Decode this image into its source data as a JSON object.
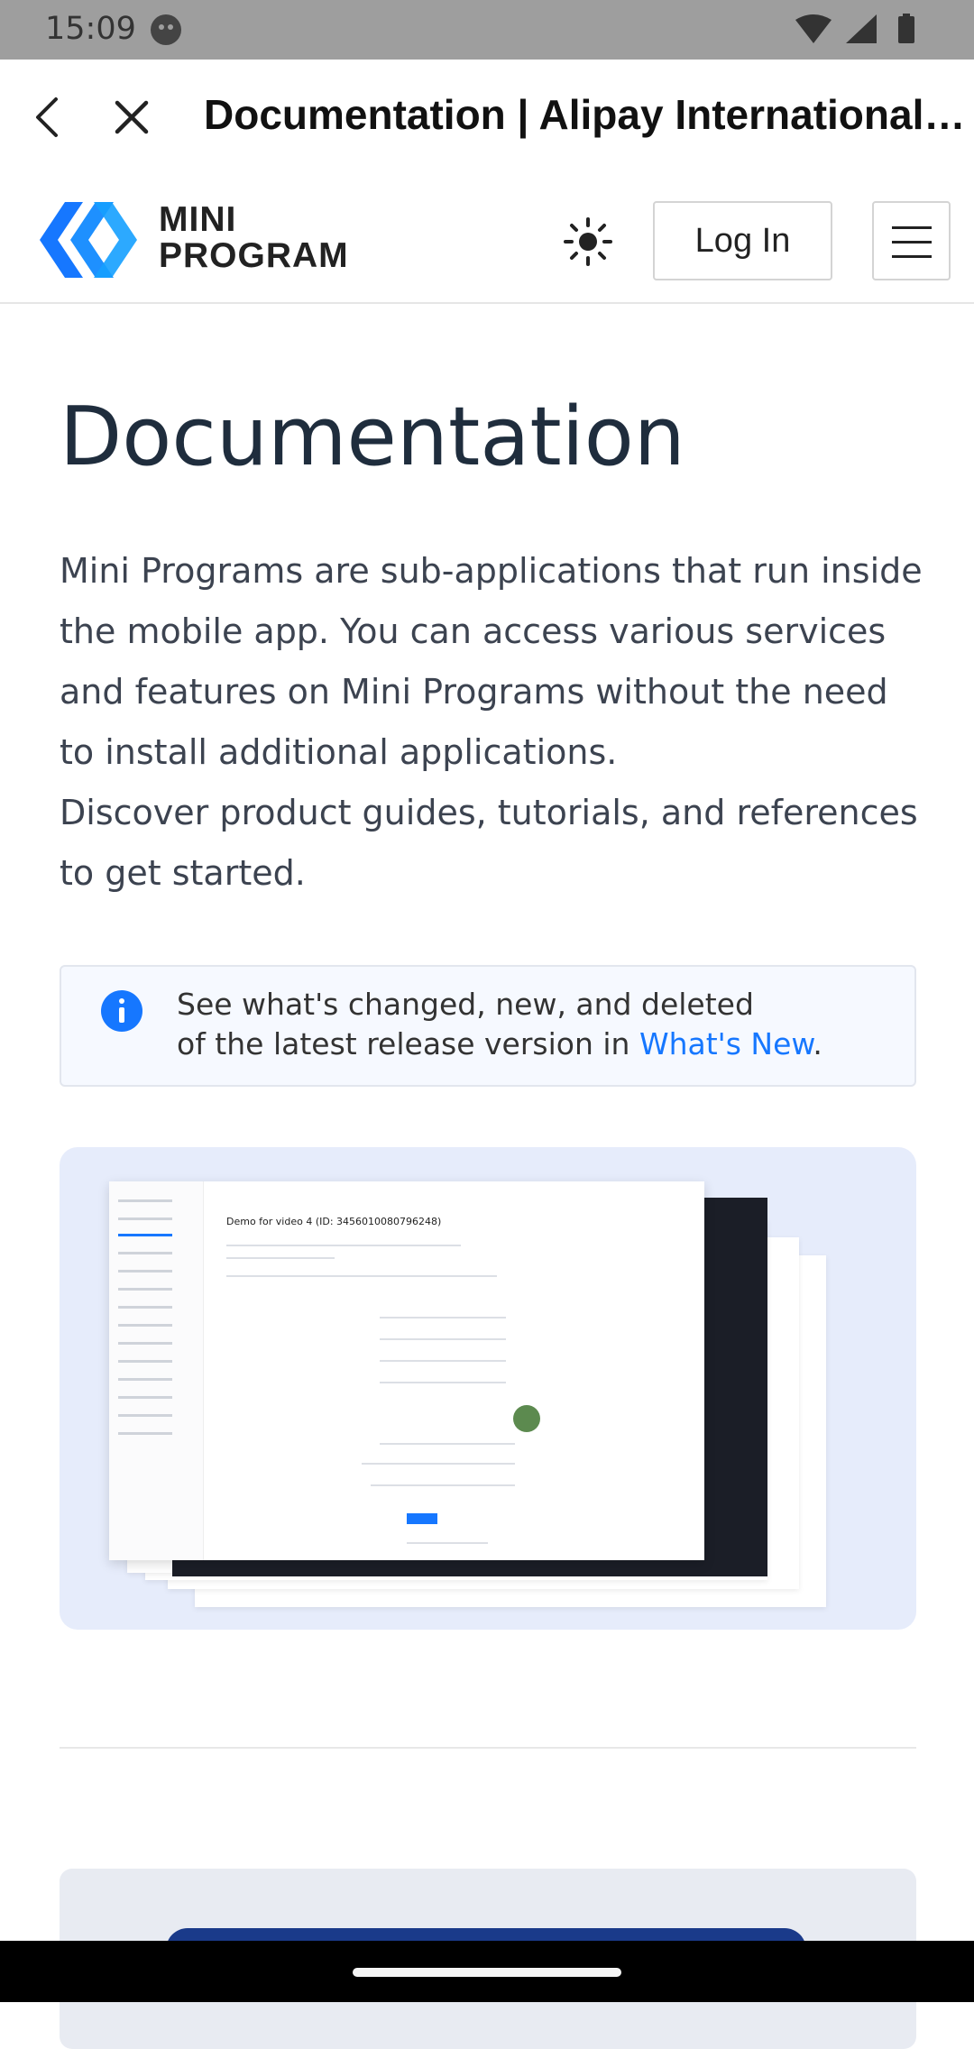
{
  "status_bar": {
    "time": "15:09",
    "icons": [
      "face-icon",
      "wifi-icon",
      "signal-icon",
      "battery-icon"
    ]
  },
  "browser": {
    "title": "Documentation | Alipay International Mini Program",
    "back_icon": "chevron-left-icon",
    "close_icon": "close-icon"
  },
  "header": {
    "logo_line1": "MINI",
    "logo_line2": "PROGRAM",
    "theme_icon": "sun-icon",
    "login_label": "Log In",
    "menu_icon": "hamburger-menu-icon"
  },
  "main": {
    "title": "Documentation",
    "intro_p1": "Mini Programs are sub-applications that run inside the mobile app. You can access various services and features on Mini Programs without the need to install additional applications.",
    "intro_p2": "Discover product guides, tutorials, and references to get started.",
    "notice": {
      "line1": "See what's changed, new, and deleted",
      "line2_prefix": "of the latest release version in ",
      "link_text": "What's New",
      "line2_suffix": ".",
      "icon": "info-icon"
    },
    "hero": {
      "screen_title": "Demo for video 4 (ID: 3456010080796248)"
    }
  },
  "colors": {
    "accent": "#1677ff",
    "title": "#1f2d3d",
    "body_text": "#3c4350",
    "hero_bg": "#e6ecfb"
  }
}
